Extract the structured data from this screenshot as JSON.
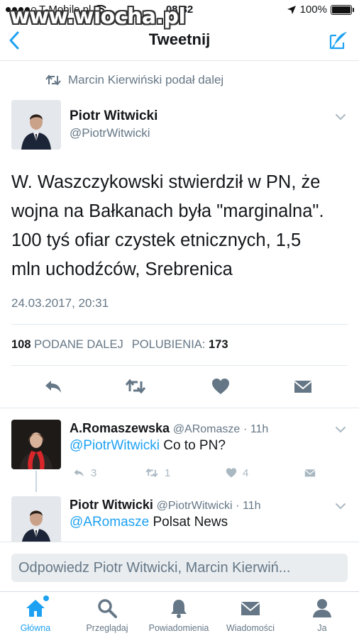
{
  "status_bar": {
    "carrier": "T-Mobile.pl",
    "time": "08:32",
    "battery": "100%",
    "watermark": "www.wiocha.pl"
  },
  "navbar": {
    "title": "Tweetnij",
    "back_icon": "chevron-left-icon",
    "compose_icon": "compose-icon"
  },
  "tweet": {
    "retweeted_by": "Marcin Kierwiński podał dalej",
    "author_name": "Piotr Witwicki",
    "author_handle": "@PiotrWitwicki",
    "text_lines": [
      "W. Waszczykowski stwierdził w PN, że",
      "wojna na Bałkanach była \"marginalna\".",
      "100 tyś ofiar czystek etnicznych, 1,5",
      "mln uchodźców,  Srebrenica"
    ],
    "date": "24.03.2017, 20:31",
    "retweets_count": "108",
    "retweets_label": "PODANE DALEJ",
    "likes_label": "POLUBIENIA:",
    "likes_count": "173"
  },
  "replies": [
    {
      "name": "A.Romaszewska",
      "handle": "@ARomasze",
      "time": "· 11h",
      "mention": "@PiotrWitwicki",
      "text": " Co to PN?",
      "reply_count": "3",
      "retweet_count": "1",
      "like_count": "4"
    },
    {
      "name": "Piotr Witwicki",
      "handle": "@PiotrWitwicki",
      "time": "· 11h",
      "mention": "@ARomasze",
      "text": " Polsat News"
    }
  ],
  "composer": {
    "placeholder": "Odpowiedz Piotr Witwicki, Marcin Kierwiń..."
  },
  "tabs": [
    {
      "label": "Główna",
      "icon": "home-icon",
      "active": true
    },
    {
      "label": "Przeglądaj",
      "icon": "search-icon",
      "active": false
    },
    {
      "label": "Powiadomienia",
      "icon": "bell-icon",
      "active": false
    },
    {
      "label": "Wiadomości",
      "icon": "envelope-icon",
      "active": false
    },
    {
      "label": "Ja",
      "icon": "profile-icon",
      "active": false
    }
  ],
  "colors": {
    "accent": "#1da1f2",
    "text": "#14171a",
    "muted": "#657786",
    "action_gray": "#657786"
  }
}
